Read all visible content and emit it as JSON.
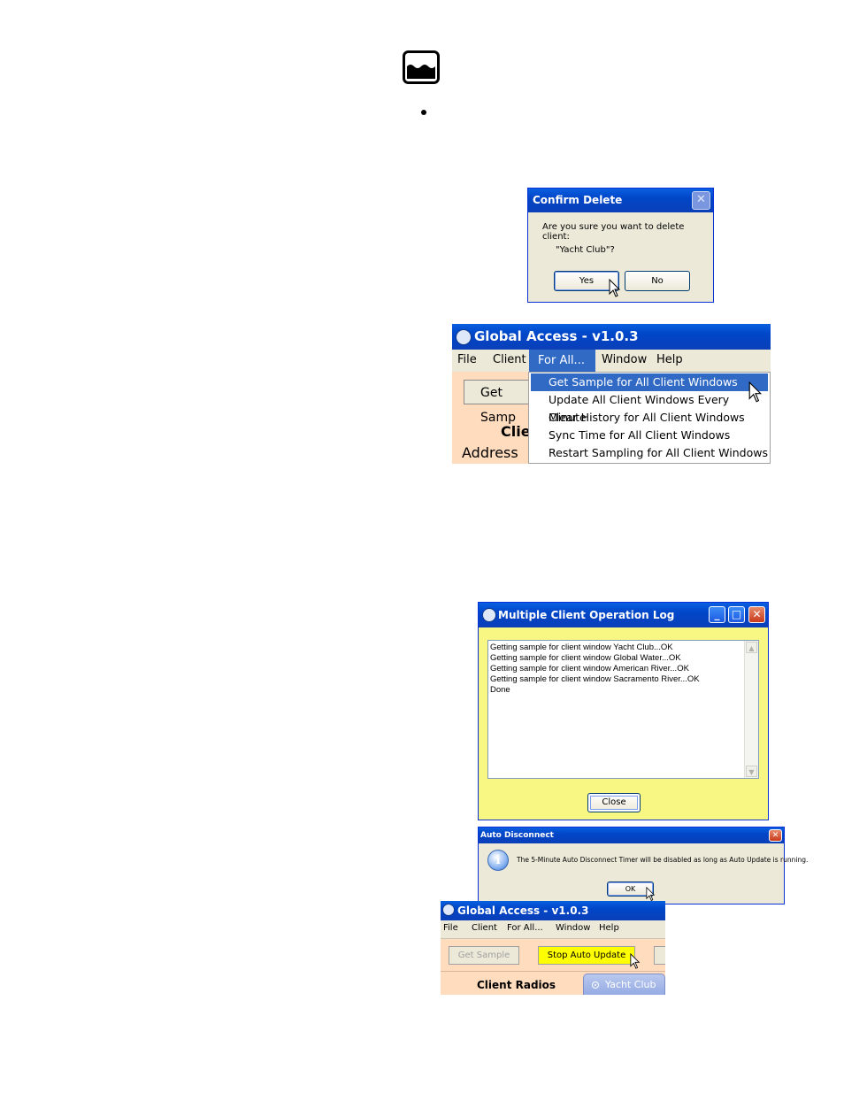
{
  "logo": {
    "icon": "water-waves-icon"
  },
  "confirm_dialog": {
    "title": "Confirm Delete",
    "message": "Are you sure you want to delete client:",
    "client_name": "\"Yacht Club\"?",
    "yes_label": "Yes",
    "no_label": "No",
    "close_glyph": "✕"
  },
  "main_window_1": {
    "title": "Global Access - v1.0.3",
    "menu": [
      "File",
      "Client",
      "For All...",
      "Window",
      "Help"
    ],
    "active_menu": "For All...",
    "get_sample_partial": "Get Samp",
    "clients_partial": "Clie",
    "address_partial": "Address B",
    "dropdown": [
      "Get Sample for All Client Windows",
      "Update All Client Windows Every Minute",
      "Clear History for All Client Windows",
      "Sync Time for All Client Windows",
      "Restart Sampling for All Client Windows"
    ],
    "highlighted_item": "Get Sample for All Client Windows"
  },
  "operation_log": {
    "title": "Multiple Client Operation Log",
    "lines": [
      "Getting sample for client window Yacht Club...OK",
      "Getting sample for client window Global Water...OK",
      "Getting sample for client window American River...OK",
      "Getting sample for client window Sacramento River...OK",
      "Done"
    ],
    "close_label": "Close",
    "min_glyph": "_",
    "max_glyph": "□",
    "x_glyph": "✕",
    "scroll_up": "▲",
    "scroll_down": "▼"
  },
  "auto_disconnect": {
    "title": "Auto Disconnect",
    "message": "The 5-Minute Auto Disconnect Timer will be disabled as long as Auto Update is running.",
    "ok_label": "OK",
    "info_glyph": "i",
    "x_glyph": "✕"
  },
  "main_window_2": {
    "title": "Global Access - v1.0.3",
    "menu": [
      "File",
      "Client",
      "For All...",
      "Window",
      "Help"
    ],
    "get_sample_label": "Get Sample",
    "stop_label": "Stop Auto Update",
    "client_radios_label": "Client Radios",
    "tab_label": "Yacht Club"
  },
  "colors": {
    "xp_blue": "#0046c8",
    "menu_highlight": "#316ac5",
    "peach": "#ffdcbe",
    "log_yellow": "#f8f784",
    "stop_yellow": "#ffff00"
  }
}
